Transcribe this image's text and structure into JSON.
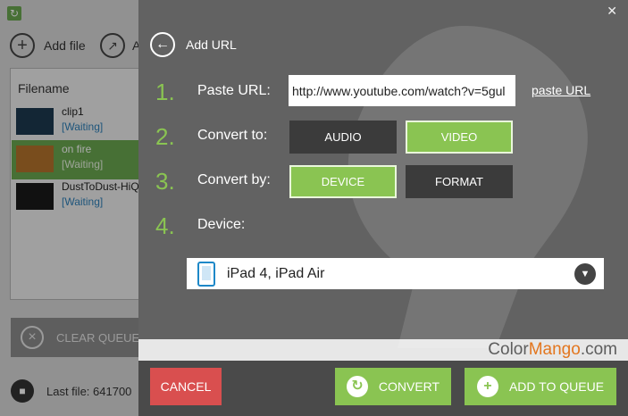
{
  "background_app": {
    "toolbar": {
      "add_file_label": "Add file",
      "add_url_label": "A"
    },
    "file_list": {
      "header": "Filename",
      "items": [
        {
          "name": "clip1",
          "status": "[Waiting]"
        },
        {
          "name": "on fire",
          "status": "[Waiting]",
          "selected": true
        },
        {
          "name": "DustToDust-HiQ",
          "status": "[Waiting]"
        }
      ]
    },
    "clear_queue_label": "CLEAR QUEUE",
    "status_bar_text": "Last file: 641700"
  },
  "modal": {
    "title": "Add URL",
    "steps": [
      {
        "num": "1.",
        "label": "Paste URL:"
      },
      {
        "num": "2.",
        "label": "Convert to:"
      },
      {
        "num": "3.",
        "label": "Convert by:"
      },
      {
        "num": "4.",
        "label": "Device:"
      }
    ],
    "url_value": "http://www.youtube.com/watch?v=5gul",
    "paste_url_link": "paste URL",
    "convert_to": {
      "audio_label": "AUDIO",
      "video_label": "VIDEO",
      "selected": "VIDEO"
    },
    "convert_by": {
      "device_label": "DEVICE",
      "format_label": "FORMAT",
      "selected": "DEVICE"
    },
    "device_value": "iPad 4, iPad Air",
    "brand": {
      "prefix": "Color",
      "accent": "Mango",
      "suffix": ".com"
    },
    "buttons": {
      "cancel": "CANCEL",
      "convert": "CONVERT",
      "add_to_queue": "ADD TO QUEUE"
    }
  },
  "colors": {
    "accent_green": "#8ac452",
    "cancel_red": "#d94f4f",
    "link_blue": "#2e7fb8",
    "brand_orange": "#e3761e"
  },
  "icons": [
    "app-logo-icon",
    "add-icon",
    "add-url-icon",
    "clear-icon",
    "folder-icon",
    "close-icon",
    "back-arrow-icon",
    "tablet-icon",
    "chevron-down-icon",
    "convert-icon",
    "plus-icon"
  ]
}
